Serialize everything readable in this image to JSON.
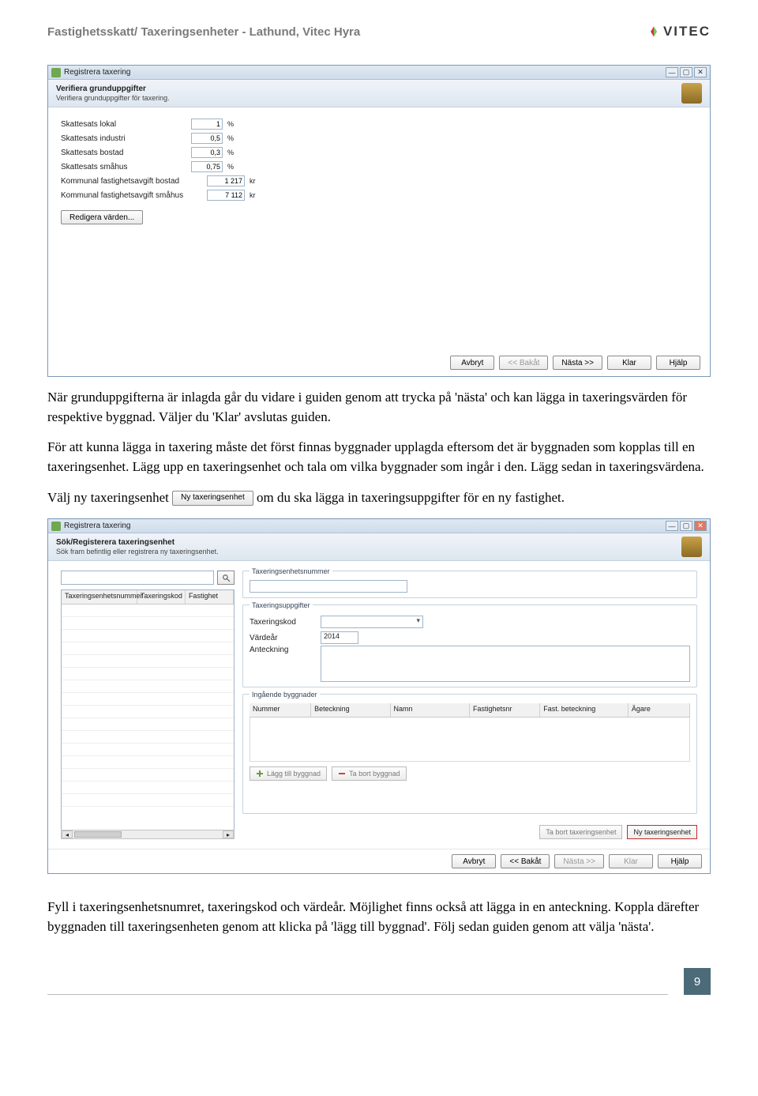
{
  "doc": {
    "header_title": "Fastighetsskatt/ Taxeringsenheter - Lathund, Vitec Hyra",
    "logo_text": "VITEC",
    "page_number": "9"
  },
  "para1": "När grunduppgifterna är inlagda går du vidare i guiden genom att trycka på 'nästa' och kan lägga in taxeringsvärden för respektive byggnad. Väljer du 'Klar' avslutas guiden.",
  "para2": "För att kunna lägga in taxering måste det först finnas byggnader upplagda eftersom det är byggnaden som kopplas till en taxeringsenhet. Lägg upp en taxeringsenhet och tala om vilka byggnader som ingår i den. Lägg sedan in taxeringsvärdena.",
  "para3_prefix": "Välj ny taxeringsenhet ",
  "para3_button": "Ny taxeringsenhet",
  "para3_suffix": " om du ska lägga in taxeringsuppgifter för en ny fastighet.",
  "para4": "Fyll i taxeringsenhetsnumret, taxeringskod och värdeår. Möjlighet finns också att lägga in en anteckning. Koppla därefter byggnaden till taxeringsenheten genom att klicka på 'lägg till byggnad'. Följ sedan guiden genom att välja 'nästa'.",
  "screen1": {
    "title": "Registrera taxering",
    "band_title": "Verifiera grunduppgifter",
    "band_sub": "Verifiera grunduppgifter för taxering.",
    "rows": [
      {
        "label": "Skattesats lokal",
        "value": "1",
        "unit": "%"
      },
      {
        "label": "Skattesats industri",
        "value": "0,5",
        "unit": "%"
      },
      {
        "label": "Skattesats bostad",
        "value": "0,3",
        "unit": "%"
      },
      {
        "label": "Skattesats småhus",
        "value": "0,75",
        "unit": "%"
      }
    ],
    "rows_kr": [
      {
        "label": "Kommunal fastighetsavgift bostad",
        "value": "1 217",
        "unit": "kr"
      },
      {
        "label": "Kommunal fastighetsavgift småhus",
        "value": "7 112",
        "unit": "kr"
      }
    ],
    "edit_btn": "Redigera värden...",
    "wizard": {
      "cancel": "Avbryt",
      "back": "<< Bakåt",
      "next": "Nästa >>",
      "done": "Klar",
      "help": "Hjälp"
    }
  },
  "screen2": {
    "title": "Registrera taxering",
    "band_title": "Sök/Registerera taxeringsenhet",
    "band_sub": "Sök fram befintlig eller registrera ny taxeringsenhet.",
    "left_cols": [
      "Taxeringsenhetsnummer",
      "Taxeringskod",
      "Fastighet"
    ],
    "group1": {
      "title": "Taxeringsenhetsnummer",
      "field_label": ""
    },
    "group2": {
      "title": "Taxeringsuppgifter",
      "kod": "Taxeringskod",
      "vardear": "Värdeår",
      "vardear_val": "2014",
      "anteckning": "Anteckning"
    },
    "group3": {
      "title": "Ingående byggnader",
      "cols": [
        "Nummer",
        "Beteckning",
        "Namn",
        "Fastighetsnr",
        "Fast. beteckning",
        "Ägare"
      ],
      "btn_add": "Lägg till byggnad",
      "btn_remove": "Ta bort byggnad"
    },
    "right_btns": {
      "del": "Ta bort taxeringsenhet",
      "new": "Ny taxeringsenhet"
    },
    "wizard": {
      "cancel": "Avbryt",
      "back": "<< Bakåt",
      "next": "Nästa >>",
      "done": "Klar",
      "help": "Hjälp"
    }
  }
}
